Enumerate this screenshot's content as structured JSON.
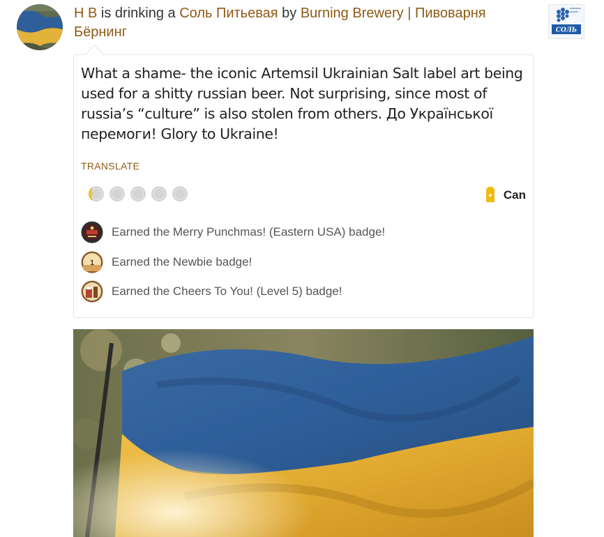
{
  "header": {
    "user": "Н В",
    "drinking_text": "is drinking a",
    "beer": "Соль Питьевая",
    "by_text": "by",
    "brewery": "Burning Brewery | Пивоварня Бёрнинг"
  },
  "beer_label": {
    "brand_text": "СОЛЬ"
  },
  "comment": "What a shame- the iconic Artemsil Ukrainian Salt label art being used for a shitty russian beer. Not surprising, since most of russia’s “culture” is also stolen from others. До Української перемоги! Glory to Ukraine!",
  "translate_label": "Translate",
  "rating": {
    "value": 0.25,
    "max": 5
  },
  "serving": {
    "label": "Can",
    "icon": "can-icon"
  },
  "badges": [
    {
      "text": "Earned the Merry Punchmas! (Eastern USA) badge!",
      "icon": "merry-punchmas-badge-icon"
    },
    {
      "text": "Earned the Newbie badge!",
      "icon": "newbie-badge-icon",
      "level": "1"
    },
    {
      "text": "Earned the Cheers To You! (Level 5) badge!",
      "icon": "cheers-badge-icon"
    }
  ],
  "colors": {
    "link": "#8e5a14",
    "flag_blue": "#2f5f9a",
    "flag_yellow": "#e0a92f",
    "cap_gray": "#d4d4d4",
    "cap_gold": "#f2b90f"
  }
}
